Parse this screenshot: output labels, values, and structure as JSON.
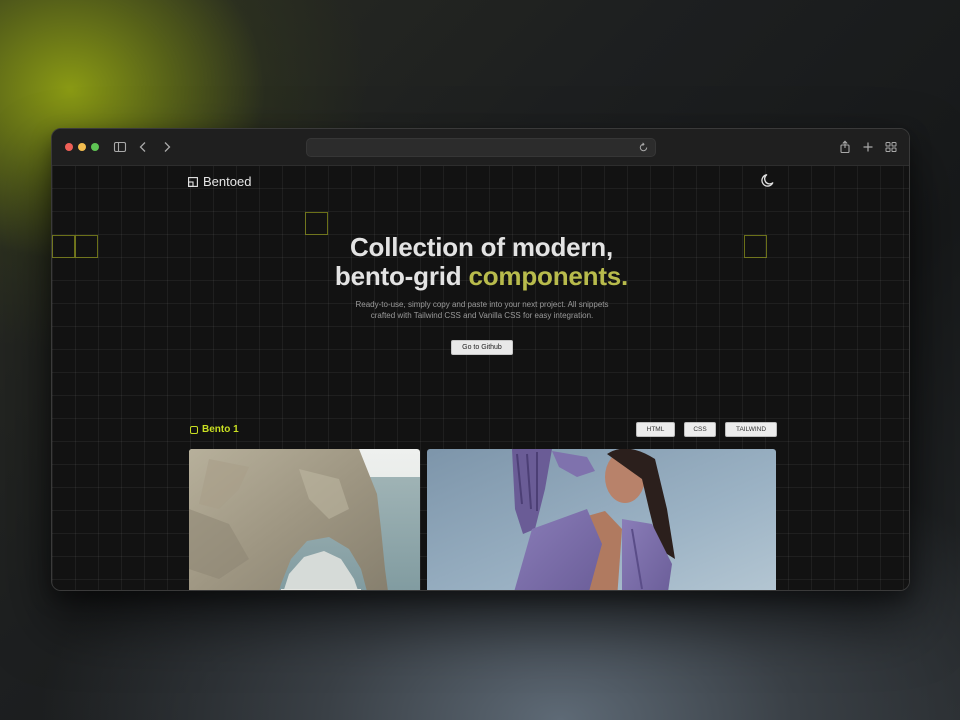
{
  "site": {
    "logo_text": "Bentoed",
    "theme_toggle_icon": "moon-icon"
  },
  "hero": {
    "title_line1": "Collection of modern,",
    "title_line2_plain": "bento-grid ",
    "title_line2_accent": "components.",
    "subtitle_line1": "Ready-to-use, simply copy and paste into your next project. All snippets",
    "subtitle_line2": "crafted with Tailwind CSS and Vanilla CSS for easy integration.",
    "cta_label": "Go to Github"
  },
  "section": {
    "label": "Bento 1",
    "tabs": [
      {
        "label": "HTML"
      },
      {
        "label": "CSS"
      },
      {
        "label": "TAILWIND"
      }
    ]
  },
  "colors": {
    "accent_green": "#c9df22",
    "title_accent": "#b8bb4c",
    "page_bg": "#121212"
  }
}
